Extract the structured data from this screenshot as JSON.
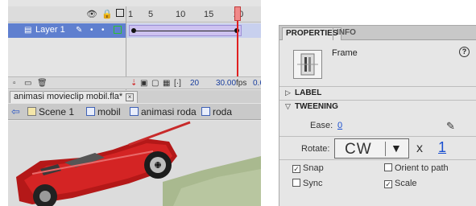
{
  "timeline": {
    "frame_numbers": [
      "1",
      "5",
      "10",
      "15",
      "20"
    ],
    "layer": {
      "name": "Layer 1"
    },
    "footer": {
      "current_frame": "20",
      "frame_rate": "30.00",
      "fps_unit": "fps",
      "elapsed": "0.6"
    }
  },
  "document": {
    "tab_title": "animasi movieclip mobil.fla*",
    "tab_close": "×",
    "breadcrumbs": [
      "Scene 1",
      "mobil",
      "animasi roda",
      "roda"
    ]
  },
  "properties": {
    "tabs": [
      "PROPERTIES",
      "INFO"
    ],
    "frame_label": "Frame",
    "help_glyph": "?",
    "sections": {
      "label": "LABEL",
      "tweening": "TWEENING"
    },
    "ease": {
      "label": "Ease:",
      "value": "0"
    },
    "rotate": {
      "label": "Rotate:",
      "direction": "CW",
      "times_symbol": "x",
      "count": "1"
    },
    "checkboxes": {
      "snap": {
        "label": "Snap",
        "checked": true
      },
      "orient": {
        "label": "Orient to path",
        "checked": false
      },
      "sync": {
        "label": "Sync",
        "checked": false
      },
      "scale": {
        "label": "Scale",
        "checked": true
      }
    }
  },
  "colors": {
    "layer_selected": "#5f7fcf",
    "tween_fill": "#cdc2f0",
    "playhead": "#e02020",
    "link_blue": "#1a4fd0",
    "car_body": "#d42424"
  }
}
